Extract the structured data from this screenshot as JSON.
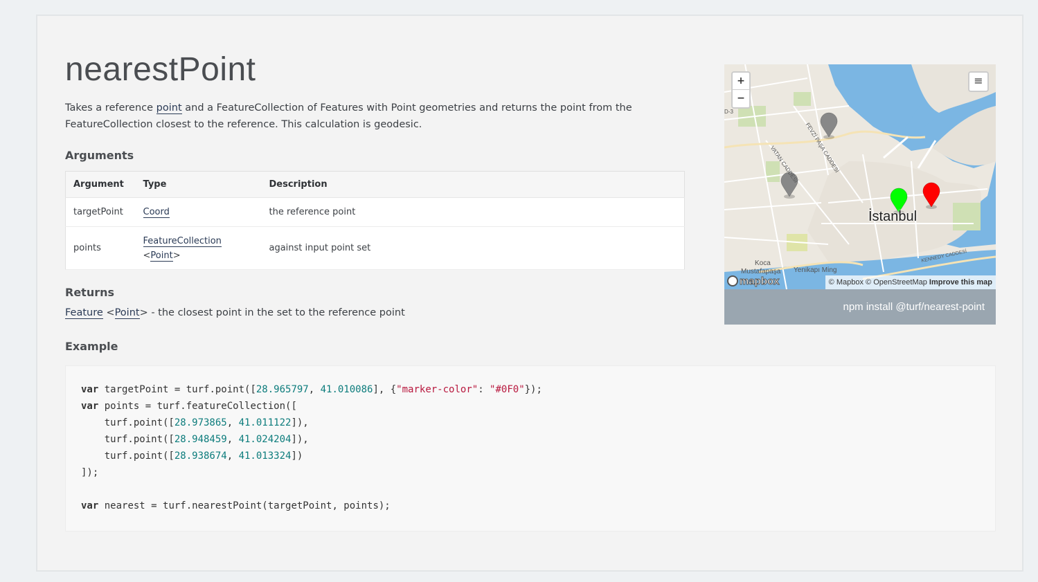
{
  "page": {
    "title": "nearestPoint",
    "description_parts": {
      "before": "Takes a reference ",
      "link": "point",
      "after": " and a FeatureCollection of Features with Point geometries and returns the point from the FeatureCollection closest to the reference. This calculation is geodesic."
    }
  },
  "arguments": {
    "heading": "Arguments",
    "columns": [
      "Argument",
      "Type",
      "Description"
    ],
    "rows": [
      {
        "argument": "targetPoint",
        "type": "Coord",
        "description": "the reference point"
      },
      {
        "argument": "points",
        "type_main": "FeatureCollection",
        "type_lt": "<",
        "type_inner": "Point",
        "type_gt": ">",
        "description": "against input point set"
      }
    ]
  },
  "returns": {
    "heading": "Returns",
    "type_main": "Feature",
    "type_lt": " <",
    "type_inner": "Point",
    "type_gt": ">",
    "text": " - the closest point in the set to the reference point"
  },
  "example": {
    "heading": "Example"
  },
  "map": {
    "zoom_in": "+",
    "zoom_out": "−",
    "layers_icon": "layers-icon",
    "city_label": "İstanbul",
    "labels": [
      "Koca",
      "Mustafapaşa",
      "Yenikapı Ming",
      "FEVZİ PAŞA CADDESİ",
      "VATAN CADDESİ",
      "KENNEDY CADDESİ",
      "D-3"
    ],
    "logo": "mapbox",
    "attribution_mapbox": "© Mapbox",
    "attribution_osm": "© OpenStreetMap",
    "attribution_improve": "Improve this map",
    "marker_colors": {
      "target": "#00ff00",
      "nearest": "#ff0000",
      "other": "#888888"
    },
    "water_color": "#7bb6e3"
  },
  "npm": {
    "label": "npm install @turf/nearest-point"
  }
}
